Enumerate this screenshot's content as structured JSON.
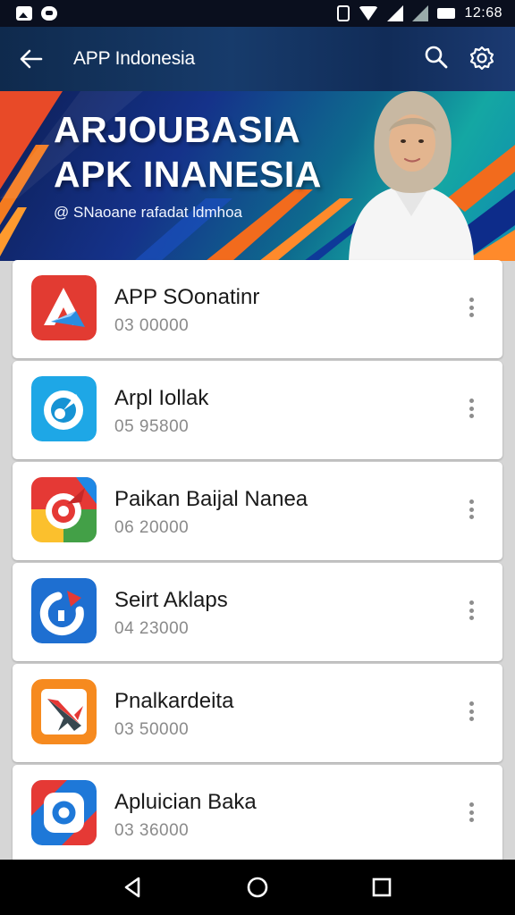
{
  "status_bar": {
    "time": "12:68"
  },
  "app_bar": {
    "title": "APP Indonesia"
  },
  "banner": {
    "title_line1": "ARJOUBASIA",
    "title_line2": "APK INANESIA",
    "subtitle": "@ SNaoane rafadat ldmhoa"
  },
  "apps": [
    {
      "name": "APP SOonatinr",
      "meta": "03  00000",
      "icon": "red-arrow-app-icon",
      "colors": [
        "#e53935",
        "#c62828"
      ]
    },
    {
      "name": "Arpl Iollak",
      "meta": "05  95800",
      "icon": "blue-circle-app-icon",
      "colors": [
        "#29b6f6",
        "#0288d1"
      ]
    },
    {
      "name": "Paikan Baijal Nanea",
      "meta": "06  20000",
      "icon": "colorful-target-app-icon",
      "colors": [
        "#e53935",
        "#fbc02d",
        "#43a047",
        "#1e88e5"
      ]
    },
    {
      "name": "Seirt Aklaps",
      "meta": "04  23000",
      "icon": "refresh-app-icon",
      "colors": [
        "#1e88e5",
        "#1565c0"
      ]
    },
    {
      "name": "Pnalkardeita",
      "meta": "03  50000",
      "icon": "rocket-app-icon",
      "colors": [
        "#fb8c00",
        "#ef6c00"
      ]
    },
    {
      "name": "Apluician Baka",
      "meta": "03  36000",
      "icon": "camera-app-icon",
      "colors": [
        "#1e88e5",
        "#e53935"
      ]
    }
  ],
  "colors": {
    "app_bar": "#163766",
    "accent": "#14a7a3",
    "nav_bar": "#000000"
  }
}
